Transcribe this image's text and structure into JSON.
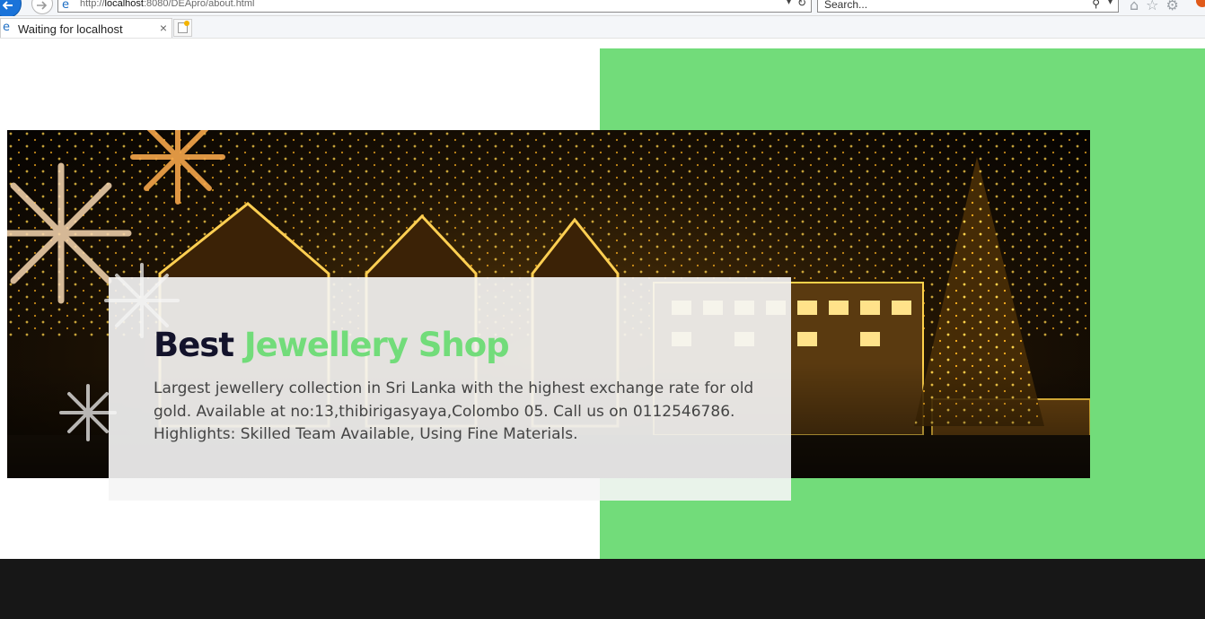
{
  "browser": {
    "url_prefix": "http://",
    "url_host": "localhost",
    "url_rest": ":8080/DEApro/about.html",
    "search_placeholder": "Search...",
    "tab_title": "Waiting for localhost",
    "tab_close": "×",
    "icons": [
      "back-icon",
      "forward-icon",
      "refresh-icon",
      "search-icon",
      "home-icon",
      "star-icon",
      "gear-icon"
    ]
  },
  "hero": {
    "title_part1": "Best ",
    "title_part2": "Jewellery Shop",
    "description": "Largest jewellery collection in Sri Lanka with the highest exchange rate for old gold. Available at no:13,thibirigasyaya,Colombo 05. Call us on 0112546786. Highlights: Skilled Team Available, Using Fine Materials."
  },
  "colors": {
    "accent": "#72dc7a",
    "title_dark": "#13132b",
    "footer": "#171717"
  }
}
